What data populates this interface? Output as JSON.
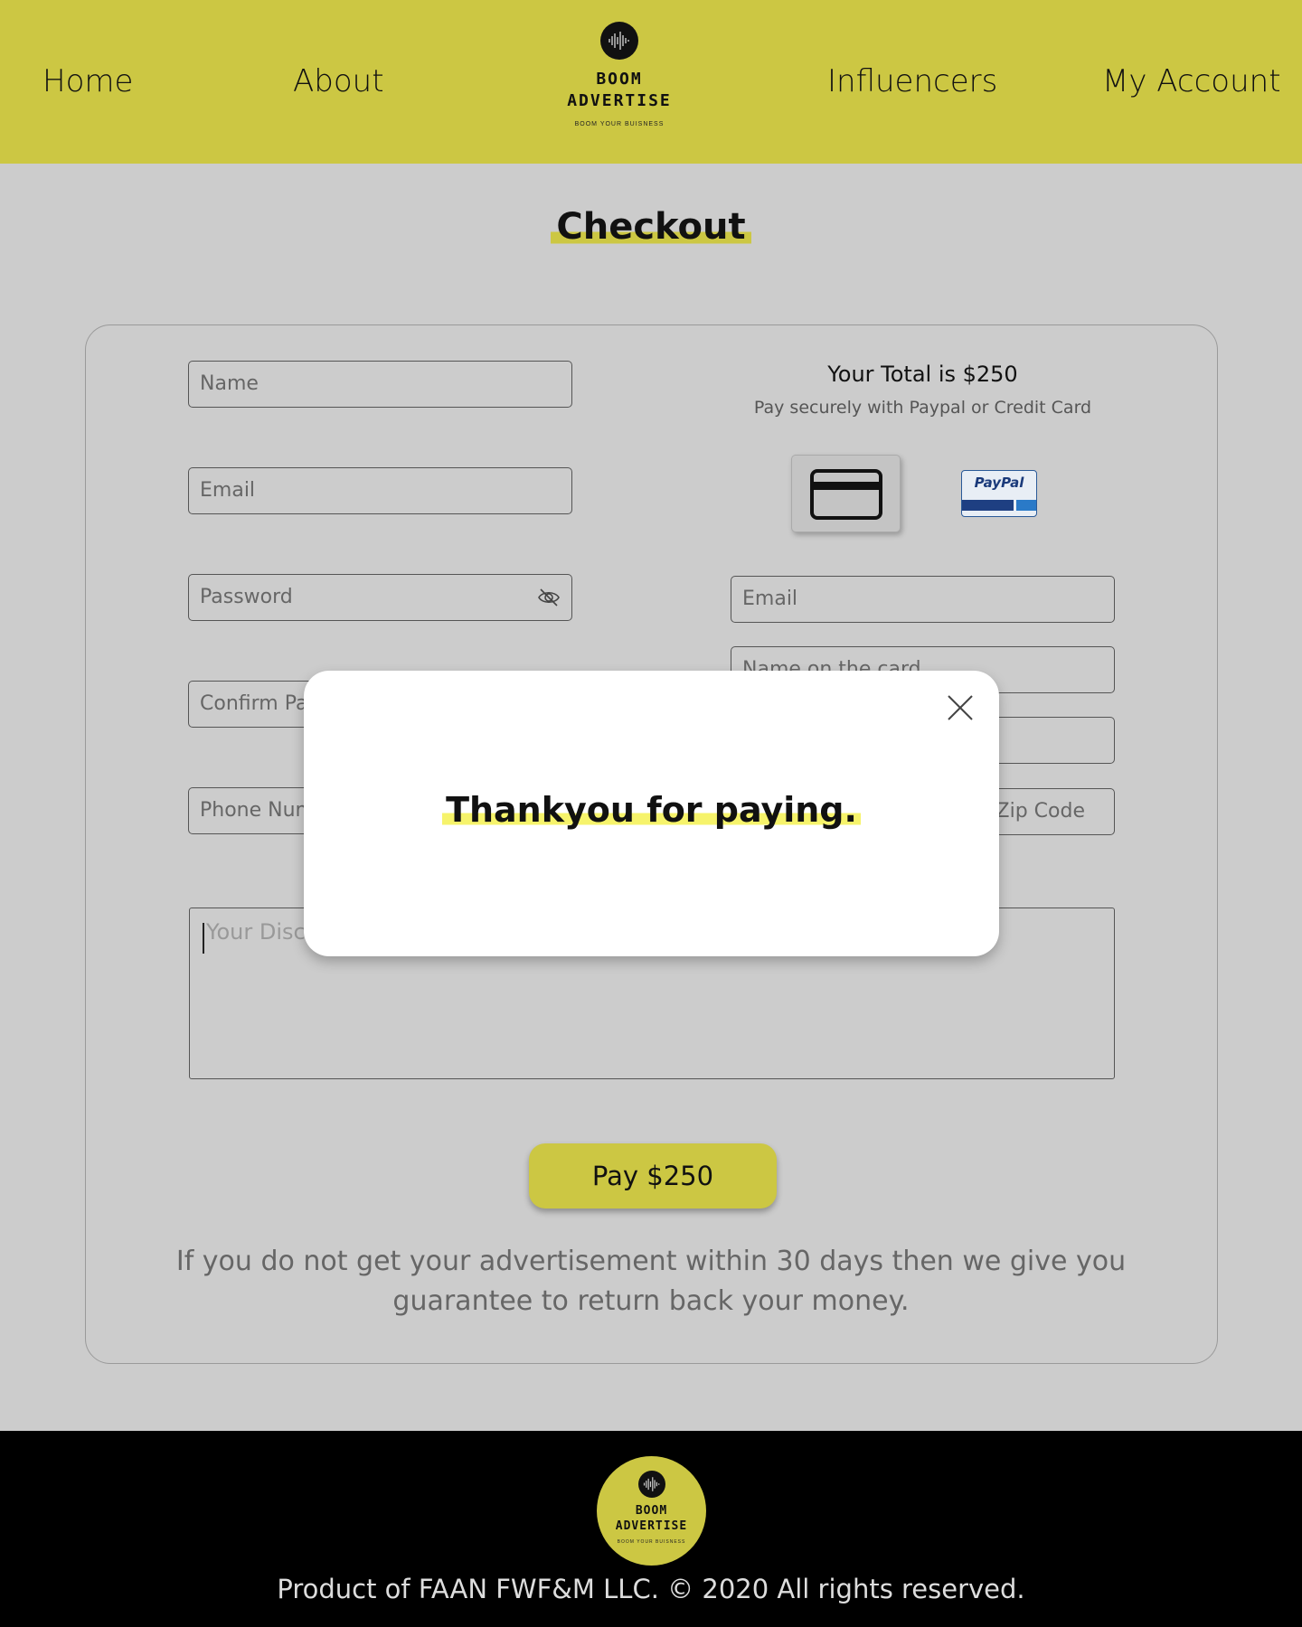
{
  "nav": {
    "home": "Home",
    "about": "About",
    "influencers": "Influencers",
    "account": "My Account"
  },
  "brand": {
    "name_line1": "BOOM",
    "name_line2": "ADVERTISE",
    "tagline": "BOOM YOUR BUISNESS"
  },
  "page": {
    "title": "Checkout"
  },
  "form": {
    "name_placeholder": "Name",
    "email_placeholder": "Email",
    "password_placeholder": "Password",
    "confirm_placeholder": "Confirm Password",
    "phone_placeholder": "Phone Number",
    "discount_placeholder": "Your Discount Code"
  },
  "payment": {
    "total": "Your Total is $250",
    "subtitle": "Pay securely with Paypal or Credit Card",
    "paypal_label": "PayPal",
    "email_placeholder": "Email",
    "card_name_placeholder": "Name on the card",
    "card_number_placeholder": "",
    "zip_placeholder": "Zip Code",
    "pay_button": "Pay $250"
  },
  "guarantee": "If you do not get your advertisement within 30 days then we give you guarantee to return back your money.",
  "modal": {
    "message": "Thankyou for paying."
  },
  "footer": {
    "copyright": "Product of FAAN FWF&M LLC.  © 2020 All rights reserved."
  },
  "colors": {
    "brand_yellow": "#ccc743",
    "highlight_yellow": "#f6f36b",
    "background": "#cccccc",
    "footer": "#000000"
  }
}
